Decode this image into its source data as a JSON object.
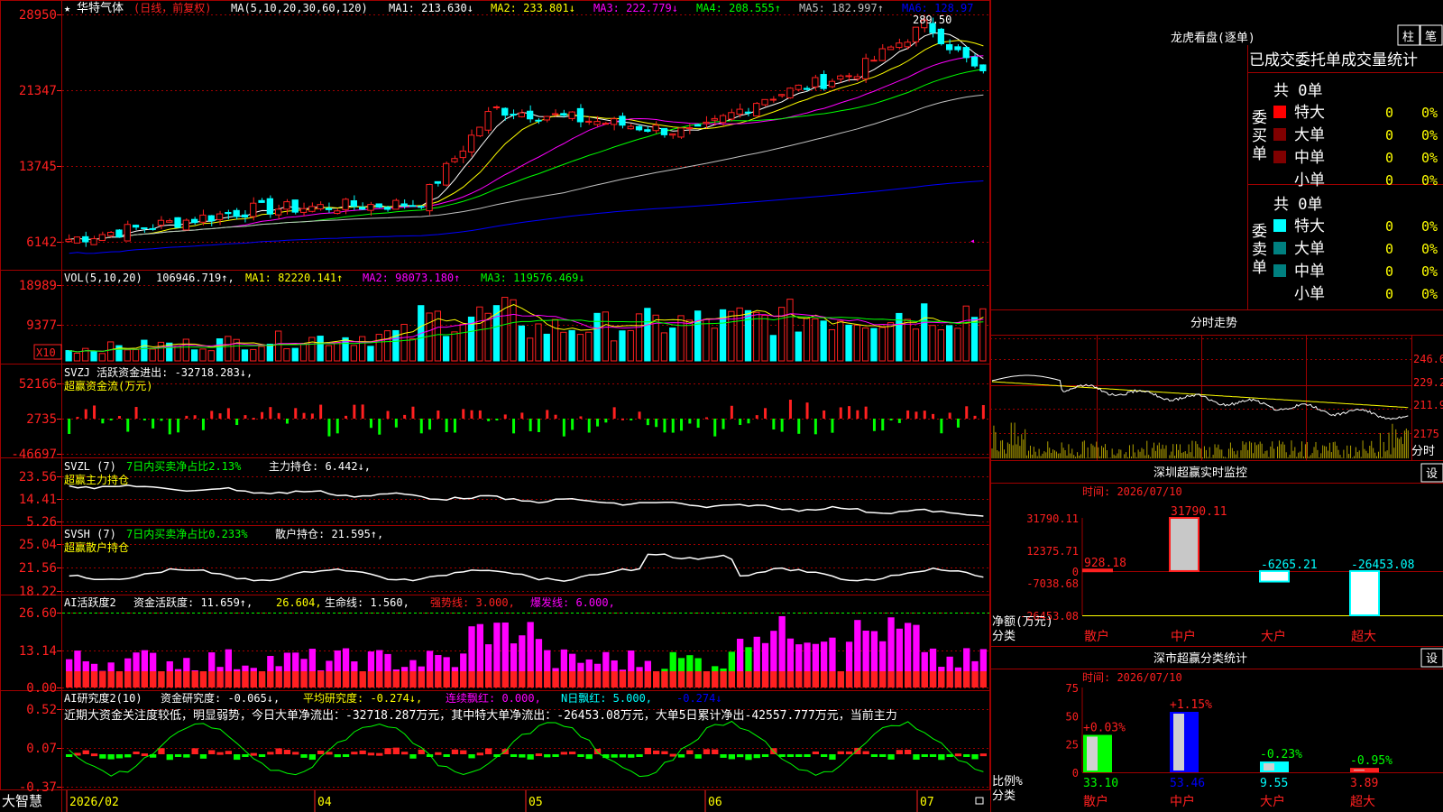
{
  "colors": {
    "up": "#ff2020",
    "down": "#00ffff",
    "ma1": "#ffffff",
    "ma2": "#ffff00",
    "ma3": "#ff00ff",
    "ma4": "#00ff00",
    "ma5": "#c0c0c0",
    "ma6": "#0000ff",
    "grid": "#a00000",
    "inflow": "#ff2020",
    "outflow": "#00ff00",
    "accent": "#ffff00",
    "panelBlue": "#0000ff"
  },
  "app": {
    "brand": "大智慧"
  },
  "main": {
    "star": "★",
    "stock_name": "华特气体",
    "period": "(日线，前复权)",
    "ma_header": "MA(5,10,20,30,60,120)",
    "ma": [
      {
        "label": "MA1:",
        "value": "213.630",
        "arrow": "↓"
      },
      {
        "label": "MA2:",
        "value": "233.801",
        "arrow": "↓"
      },
      {
        "label": "MA3:",
        "value": "222.779",
        "arrow": "↓"
      },
      {
        "label": "MA4:",
        "value": "208.555",
        "arrow": "↑"
      },
      {
        "label": "MA5:",
        "value": "182.997",
        "arrow": "↑"
      },
      {
        "label": "MA6:",
        "value": "128.97",
        "arrow": ""
      }
    ],
    "yticks": [
      "28950",
      "21347",
      "13745",
      "6142"
    ],
    "high_label": "289.50"
  },
  "vol": {
    "header": "VOL(5,10,20)",
    "value": "106946.719",
    "arrow": "↑",
    "ma1": "MA1: 82220.141↑",
    "ma2": "MA2: 98073.180↑",
    "ma3": "MA3: 119576.469↓",
    "yticks": [
      "18989",
      "9377"
    ],
    "unit": "X10"
  },
  "svzj": {
    "line1": "SVZJ  活跃资金进出: -32718.283↓,",
    "line2": "超赢资金流(万元)",
    "yticks": [
      "52166",
      "2735",
      "-46697"
    ]
  },
  "svzl": {
    "title": "SVZL (7)",
    "desc": "7日内买卖净占比2.13%",
    "label": "主力持仓: 6.442↓,",
    "line2": "超赢主力持仓",
    "yticks": [
      "23.56",
      "14.41",
      "5.26"
    ]
  },
  "svsh": {
    "title": "SVSH (7)",
    "desc": "7日内买卖净占比0.233%",
    "label": "散户持仓: 21.595↑,",
    "line2": "超赢散户持仓",
    "yticks": [
      "25.04",
      "21.56",
      "18.22"
    ]
  },
  "ai1": {
    "title": "AI活跃度2",
    "label": "资金活跃度: 11.659↑,",
    "v2": "26.604,",
    "life": "生命线: 1.560,",
    "strong": "强势线: 3.000,",
    "burst": "爆发线: 6.000,",
    "yticks": [
      "26.60",
      "13.14",
      "0.00"
    ]
  },
  "ai2": {
    "title": "AI研究度2(10)",
    "label": "资金研究度: -0.065↓,",
    "avg": "平均研究度: -0.274↓,",
    "red": "连续飘红: 0.000,",
    "nred": "N日飘红: 5.000,",
    "last": "-0.274↓",
    "commentary": "近期大资金关注度较低，明显弱势，今日大单净流出：-32718.287万元，其中特大单净流出：-26453.08万元，大单5日累计净出-42557.777万元，当前主力",
    "yticks": [
      "0.52",
      "0.07",
      "-0.37"
    ]
  },
  "xaxis": [
    "2026/02",
    "04",
    "05",
    "06",
    "07"
  ],
  "longhu": {
    "title": "龙虎看盘(逐单)",
    "btn1": "柱",
    "btn2": "笔",
    "tabs": "已成交委托单成交量统计",
    "buy": {
      "side": "委买单",
      "total": "共 0单",
      "rows": [
        {
          "name": "特大",
          "v": "0",
          "p": "0%"
        },
        {
          "name": "大单",
          "v": "0",
          "p": "0%"
        },
        {
          "name": "中单",
          "v": "0",
          "p": "0%"
        },
        {
          "name": "小单",
          "v": "0",
          "p": "0%"
        }
      ]
    },
    "sell": {
      "side": "委卖单",
      "total": "共 0单",
      "rows": [
        {
          "name": "特大",
          "v": "0",
          "p": "0%"
        },
        {
          "name": "大单",
          "v": "0",
          "p": "0%"
        },
        {
          "name": "中单",
          "v": "0",
          "p": "0%"
        },
        {
          "name": "小单",
          "v": "0",
          "p": "0%"
        }
      ]
    }
  },
  "intraday": {
    "title": "分时走势",
    "yticks": [
      "246.6",
      "229.2",
      "211.9",
      "2175"
    ],
    "corner": "分时"
  },
  "monitor": {
    "title": "深圳超赢实时监控",
    "btn": "设",
    "time": "时间: 2026/07/10",
    "yticks": [
      "31790.11",
      "12375.71",
      "0",
      "-7038.68",
      "-26453.08"
    ],
    "ylabel": "净额(万元)",
    "xlabel": "分类",
    "cats": [
      "散户",
      "中户",
      "大户",
      "超大"
    ],
    "values": [
      928.18,
      31790.11,
      -6265.21,
      -26453.08
    ],
    "value_labels": [
      "928.18",
      "31790.11",
      "-6265.21",
      "-26453.08"
    ]
  },
  "classify": {
    "title": "深市超赢分类统计",
    "btn": "设",
    "time": "时间: 2026/07/10",
    "yticks": [
      "75",
      "50",
      "25",
      "0"
    ],
    "ylabel": "比例%",
    "xlabel": "分类",
    "cats": [
      "散户",
      "中户",
      "大户",
      "超大"
    ],
    "pct": [
      "+0.03%",
      "+1.15%",
      "-0.23%",
      "-0.95%"
    ],
    "shares": [
      33.1,
      53.46,
      9.55,
      3.89
    ],
    "share_labels": [
      "33.10",
      "53.46",
      "9.55",
      "3.89"
    ]
  },
  "chart_data": [
    {
      "type": "candlestick",
      "title": "华特气体 (日线，前复权)",
      "ylim": [
        6142,
        28950
      ],
      "x_start": "2026/02",
      "high": 289.5,
      "series": [
        {
          "name": "MA1",
          "last": 213.63
        },
        {
          "name": "MA2",
          "last": 233.801
        },
        {
          "name": "MA3",
          "last": 222.779
        },
        {
          "name": "MA4",
          "last": 208.555
        },
        {
          "name": "MA5",
          "last": 182.997
        },
        {
          "name": "MA6",
          "last": 128.97
        }
      ]
    },
    {
      "type": "bar",
      "title": "深圳超赢实时监控",
      "categories": [
        "散户",
        "中户",
        "大户",
        "超大"
      ],
      "values": [
        928.18,
        31790.11,
        -6265.21,
        -26453.08
      ],
      "ylabel": "净额(万元)",
      "ylim": [
        -26453.08,
        31790.11
      ]
    },
    {
      "type": "bar",
      "title": "深市超赢分类统计",
      "categories": [
        "散户",
        "中户",
        "大户",
        "超大"
      ],
      "values": [
        33.1,
        53.46,
        9.55,
        3.89
      ],
      "ylabel": "比例%",
      "ylim": [
        0,
        75
      ]
    }
  ]
}
